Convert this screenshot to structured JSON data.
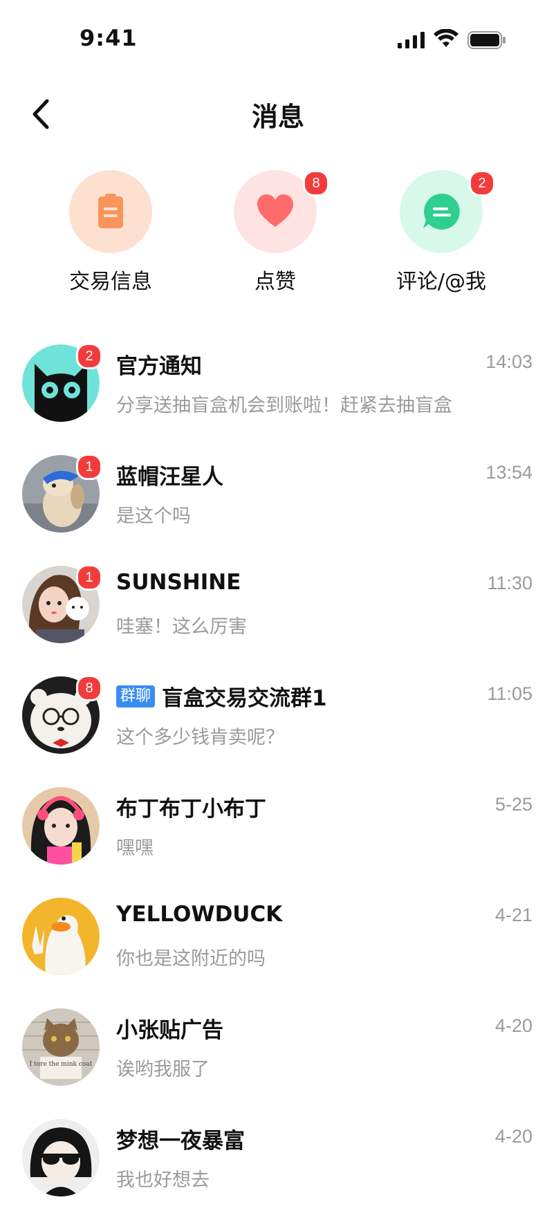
{
  "status_bar": {
    "time": "9:41"
  },
  "header": {
    "title": "消息"
  },
  "categories": [
    {
      "label": "交易信息",
      "badge": null,
      "icon": "clipboard-icon",
      "bg": "#fde0d0",
      "color": "#f9955a"
    },
    {
      "label": "点赞",
      "badge": "8",
      "icon": "heart-icon",
      "bg": "#ffe3e3",
      "color": "#ff6b6b"
    },
    {
      "label": "评论/@我",
      "badge": "2",
      "icon": "comment-icon",
      "bg": "#d8f8ea",
      "color": "#2ecf8f"
    }
  ],
  "conversations": [
    {
      "name": "官方通知",
      "message": "分享送抽盲盒机会到账啦！赶紧去抽盲盒",
      "time": "14:03",
      "badge": "2",
      "tag": ""
    },
    {
      "name": "蓝帽汪星人",
      "message": "是这个吗",
      "time": "13:54",
      "badge": "1",
      "tag": ""
    },
    {
      "name": "SUNSHINE",
      "message": "哇塞！这么厉害",
      "time": "11:30",
      "badge": "1",
      "tag": ""
    },
    {
      "name": "盲盒交易交流群1",
      "message": "这个多少钱肯卖呢？",
      "time": "11:05",
      "badge": "8",
      "tag": "群聊"
    },
    {
      "name": "布丁布丁小布丁",
      "message": "嘿嘿",
      "time": "5-25",
      "badge": null,
      "tag": ""
    },
    {
      "name": "YELLOWDUCK",
      "message": "你也是这附近的吗",
      "time": "4-21",
      "badge": null,
      "tag": ""
    },
    {
      "name": "小张贴广告",
      "message": "诶哟我服了",
      "time": "4-20",
      "badge": null,
      "tag": "",
      "sign_text": "I tore the mink coat"
    },
    {
      "name": "梦想一夜暴富",
      "message": "我也好想去",
      "time": "4-20",
      "badge": null,
      "tag": ""
    }
  ]
}
